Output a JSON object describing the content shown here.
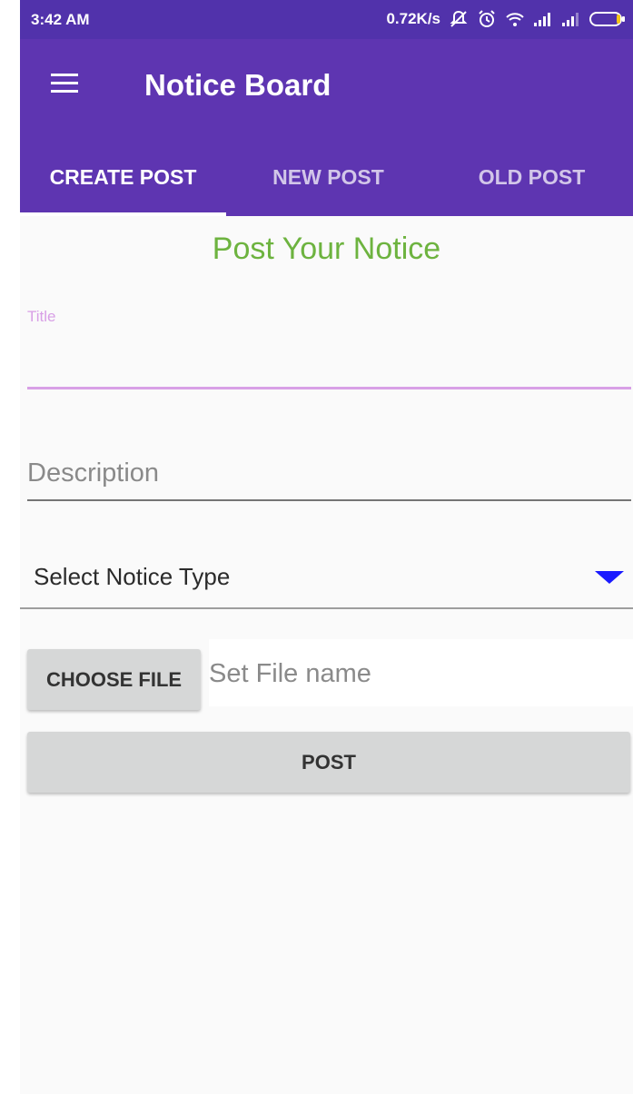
{
  "status_bar": {
    "time": "3:42 AM",
    "speed": "0.72K/s",
    "icons": [
      "notifications-off-icon",
      "alarm-icon",
      "wifi-icon",
      "signal-icon",
      "signal-icon",
      "battery-icon"
    ]
  },
  "app_bar": {
    "title": "Notice Board",
    "menu_icon": "hamburger-menu-icon",
    "color": "#5e35b1"
  },
  "tabs": [
    {
      "label": "CREATE POST",
      "selected": true
    },
    {
      "label": "NEW POST",
      "selected": false
    },
    {
      "label": "OLD POST",
      "selected": false
    }
  ],
  "form": {
    "heading": "Post Your Notice",
    "title_field": {
      "label": "Title",
      "value": ""
    },
    "description_field": {
      "placeholder": "Description",
      "value": ""
    },
    "notice_type": {
      "selected": "Select Notice Type"
    },
    "choose_file_label": "CHOOSE FILE",
    "file_name": {
      "placeholder": "Set File name",
      "value": ""
    },
    "post_label": "POST"
  },
  "colors": {
    "accent": "#d8a0e6",
    "heading": "#6db33f",
    "dropdown_arrow": "#1a1aff"
  }
}
